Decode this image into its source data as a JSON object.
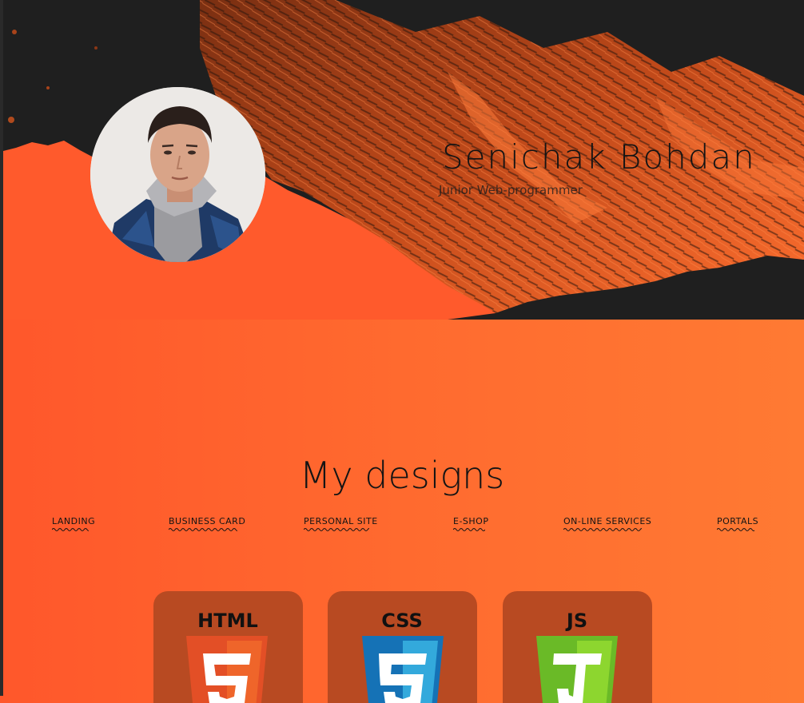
{
  "profile": {
    "name": "Senichak Bohdan",
    "role": "Junior Web-programmer"
  },
  "portfolio": {
    "title": "My designs",
    "filters": [
      "LANDING",
      "BUSINESS CARD",
      "PERSONAL SITE",
      "E-SHOP",
      "ON-LINE SERVICES",
      "PORTALS"
    ]
  },
  "tech_cards": [
    {
      "label": "HTML",
      "icon": "html5-shield-icon",
      "number": "5",
      "color": "#e34f26"
    },
    {
      "label": "CSS",
      "icon": "css3-shield-icon",
      "number": "3",
      "color": "#1572b6"
    },
    {
      "label": "JS",
      "icon": "js-shield-icon",
      "number": "J",
      "color": "#6aba27"
    }
  ],
  "colors": {
    "background": "#ff6a2f",
    "mountain_dark": "#1f1f1f",
    "card": "#b84a22"
  }
}
